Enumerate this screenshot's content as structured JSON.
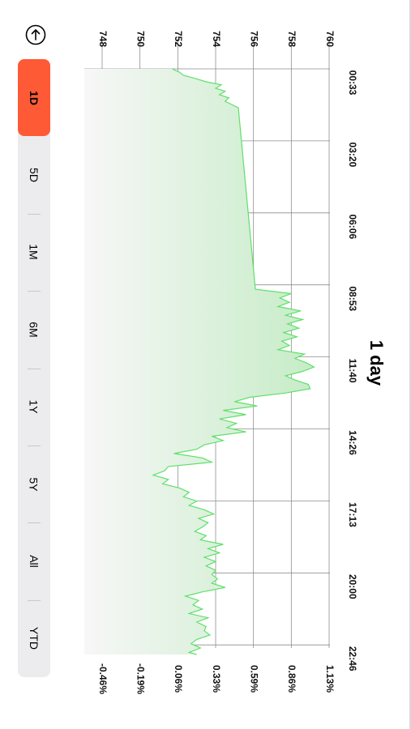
{
  "title": "1 day",
  "share_icon": "share-arrow-icon",
  "ranges": [
    "1D",
    "5D",
    "1M",
    "6M",
    "1Y",
    "5Y",
    "All",
    "YTD"
  ],
  "active_range": "1D",
  "colors": {
    "accent": "#ff5a36",
    "line": "#5ee06a",
    "fill": "#cdeecf",
    "grid": "#8e8e8e"
  },
  "chart_data": {
    "type": "area",
    "title": "1 day",
    "xlabel": "",
    "ylabel": "",
    "x_ticks": [
      "00:33",
      "03:20",
      "06:06",
      "08:53",
      "11:40",
      "14:26",
      "17:13",
      "20:00",
      "22:46"
    ],
    "y_ticks": [
      748,
      750,
      752,
      754,
      756,
      758,
      760
    ],
    "y2_ticks": [
      "-0.46%",
      "-0.19%",
      "0.06%",
      "0.33%",
      "0.59%",
      "0.86%",
      "1.13%"
    ],
    "ylim": [
      748,
      760
    ],
    "grid": true,
    "legend": "none",
    "x_unit": "minutes since 00:33",
    "points": [
      [
        0,
        751.7
      ],
      [
        8,
        752.1
      ],
      [
        15,
        752.3
      ],
      [
        22,
        752.9
      ],
      [
        30,
        753.5
      ],
      [
        37,
        754.3
      ],
      [
        45,
        754.0
      ],
      [
        52,
        754.5
      ],
      [
        60,
        754.2
      ],
      [
        67,
        754.7
      ],
      [
        75,
        754.5
      ],
      [
        90,
        755.2
      ],
      [
        510,
        756.1
      ],
      [
        520,
        758.0
      ],
      [
        530,
        757.4
      ],
      [
        540,
        757.9
      ],
      [
        550,
        757.3
      ],
      [
        560,
        758.5
      ],
      [
        570,
        757.7
      ],
      [
        580,
        758.6
      ],
      [
        590,
        757.8
      ],
      [
        600,
        758.4
      ],
      [
        610,
        757.6
      ],
      [
        620,
        758.3
      ],
      [
        630,
        757.5
      ],
      [
        640,
        757.9
      ],
      [
        650,
        757.3
      ],
      [
        660,
        758.7
      ],
      [
        670,
        758.2
      ],
      [
        680,
        758.8
      ],
      [
        690,
        759.2
      ],
      [
        700,
        758.6
      ],
      [
        710,
        757.7
      ],
      [
        720,
        758.2
      ],
      [
        730,
        758.9
      ],
      [
        740,
        759.0
      ],
      [
        750,
        757.7
      ],
      [
        760,
        755.8
      ],
      [
        770,
        755.0
      ],
      [
        780,
        756.2
      ],
      [
        790,
        754.4
      ],
      [
        800,
        755.6
      ],
      [
        810,
        754.2
      ],
      [
        820,
        755.1
      ],
      [
        830,
        754.6
      ],
      [
        840,
        755.6
      ],
      [
        850,
        753.8
      ],
      [
        860,
        754.4
      ],
      [
        870,
        753.4
      ],
      [
        880,
        753.0
      ],
      [
        890,
        751.8
      ],
      [
        900,
        753.3
      ],
      [
        910,
        753.8
      ],
      [
        920,
        751.5
      ],
      [
        930,
        751.3
      ],
      [
        940,
        750.7
      ],
      [
        950,
        751.5
      ],
      [
        960,
        751.2
      ],
      [
        970,
        752.1
      ],
      [
        980,
        752.6
      ],
      [
        990,
        752.3
      ],
      [
        1000,
        753.0
      ],
      [
        1010,
        752.6
      ],
      [
        1020,
        753.4
      ],
      [
        1030,
        753.9
      ],
      [
        1040,
        753.1
      ],
      [
        1050,
        753.6
      ],
      [
        1060,
        753.3
      ],
      [
        1070,
        752.9
      ],
      [
        1080,
        753.5
      ],
      [
        1090,
        753.2
      ],
      [
        1100,
        754.4
      ],
      [
        1110,
        753.6
      ],
      [
        1120,
        754.2
      ],
      [
        1130,
        753.4
      ],
      [
        1140,
        754.0
      ],
      [
        1150,
        753.5
      ],
      [
        1160,
        754.0
      ],
      [
        1170,
        753.8
      ],
      [
        1180,
        754.1
      ],
      [
        1190,
        753.8
      ],
      [
        1200,
        754.5
      ],
      [
        1210,
        753.3
      ],
      [
        1220,
        752.4
      ],
      [
        1230,
        753.1
      ],
      [
        1240,
        752.8
      ],
      [
        1250,
        753.3
      ],
      [
        1260,
        752.6
      ],
      [
        1270,
        753.6
      ],
      [
        1280,
        753.0
      ],
      [
        1290,
        753.5
      ],
      [
        1300,
        753.4
      ],
      [
        1310,
        753.7
      ],
      [
        1320,
        753.0
      ],
      [
        1330,
        752.7
      ],
      [
        1340,
        753.2
      ],
      [
        1350,
        752.6
      ],
      [
        1355,
        753.0
      ]
    ]
  }
}
